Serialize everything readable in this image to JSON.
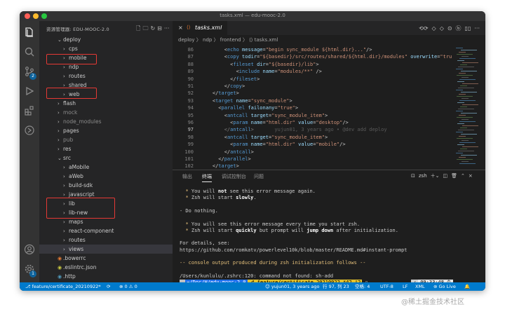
{
  "window": {
    "title": "tasks.xml — edu-mooc-2.0"
  },
  "sidebar": {
    "title": "资源管理器: EDU-MOOC-2.0",
    "tree": [
      {
        "label": "deploy",
        "indent": 0,
        "type": "folder-open",
        "dim": false
      },
      {
        "label": "cps",
        "indent": 1,
        "type": "folder",
        "dim": false
      },
      {
        "label": "mobile",
        "indent": 1,
        "type": "folder",
        "dim": false
      },
      {
        "label": "ndp",
        "indent": 1,
        "type": "folder",
        "dim": false
      },
      {
        "label": "routes",
        "indent": 1,
        "type": "folder",
        "dim": false
      },
      {
        "label": "shared",
        "indent": 1,
        "type": "folder",
        "dim": false
      },
      {
        "label": "web",
        "indent": 1,
        "type": "folder",
        "dim": false
      },
      {
        "label": "flash",
        "indent": 0,
        "type": "folder",
        "dim": false
      },
      {
        "label": "mock",
        "indent": 0,
        "type": "folder",
        "dim": true
      },
      {
        "label": "node_modules",
        "indent": 0,
        "type": "folder",
        "dim": true
      },
      {
        "label": "pages",
        "indent": 0,
        "type": "folder",
        "dim": false
      },
      {
        "label": "pub",
        "indent": 0,
        "type": "folder",
        "dim": true
      },
      {
        "label": "res",
        "indent": 0,
        "type": "folder",
        "dim": false
      },
      {
        "label": "src",
        "indent": 0,
        "type": "folder-open",
        "dim": false
      },
      {
        "label": "aMobile",
        "indent": 1,
        "type": "folder",
        "dim": false
      },
      {
        "label": "aWeb",
        "indent": 1,
        "type": "folder",
        "dim": false
      },
      {
        "label": "build-sdk",
        "indent": 1,
        "type": "folder",
        "dim": false
      },
      {
        "label": "javascript",
        "indent": 1,
        "type": "folder",
        "dim": false
      },
      {
        "label": "lib",
        "indent": 1,
        "type": "folder",
        "dim": false
      },
      {
        "label": "lib-new",
        "indent": 1,
        "type": "folder",
        "dim": false
      },
      {
        "label": "maps",
        "indent": 1,
        "type": "folder",
        "dim": false
      },
      {
        "label": "react-component",
        "indent": 1,
        "type": "folder",
        "dim": false
      },
      {
        "label": "routes",
        "indent": 1,
        "type": "folder",
        "dim": false
      },
      {
        "label": "views",
        "indent": 1,
        "type": "folder",
        "dim": false
      },
      {
        "label": ".bowerrc",
        "indent": 0,
        "type": "file",
        "dim": false
      },
      {
        "label": ".eslintrc.json",
        "indent": 0,
        "type": "file",
        "dim": false
      },
      {
        "label": ".http",
        "indent": 0,
        "type": "file",
        "dim": false
      }
    ]
  },
  "activity_badge": "2",
  "activity_badge_bottom": "1",
  "editor": {
    "tab_label": "tasks.xml",
    "breadcrumb": "deploy 〉 ndp 〉 frontend 〉 ⟨⟩ tasks.xml",
    "lines": [
      {
        "n": "86",
        "html": "        &lt;<span class='tg'>echo</span> <span class='at'>message</span>=<span class='st'>\"begin sync_module ${html.dir}...\"</span>/&gt;"
      },
      {
        "n": "87",
        "html": "        &lt;<span class='tg'>copy</span> <span class='at'>todir</span>=<span class='st'>\"${basedir}/src/routes/shared/${html.dir}/modules\"</span> <span class='at'>overwrite</span>=<span class='st'>\"tru</span>"
      },
      {
        "n": "88",
        "html": "          &lt;<span class='tg'>fileset</span> <span class='at'>dir</span>=<span class='st'>\"${basedir}/lib\"</span>&gt;"
      },
      {
        "n": "89",
        "html": "            &lt;<span class='tg'>include</span> <span class='at'>name</span>=<span class='st'>\"modules/**\"</span> /&gt;"
      },
      {
        "n": "90",
        "html": "          &lt;/<span class='tg'>fileset</span>&gt;"
      },
      {
        "n": "91",
        "html": "        &lt;/<span class='tg'>copy</span>&gt;"
      },
      {
        "n": "92",
        "html": "    &lt;/<span class='tg'>target</span>&gt;"
      },
      {
        "n": "93",
        "html": "    &lt;<span class='tg'>target</span> <span class='at'>name</span>=<span class='st'>\"sync_module\"</span>&gt;"
      },
      {
        "n": "94",
        "html": "      &lt;<span class='tg'>parallel</span> <span class='at'>failonany</span>=<span class='st'>\"true\"</span>&gt;"
      },
      {
        "n": "95",
        "html": "        &lt;<span class='tg'>antcall</span> <span class='at'>target</span>=<span class='st'>\"sync_module_item\"</span>&gt;"
      },
      {
        "n": "96",
        "html": "          &lt;<span class='tg'>param</span> <span class='at'>name</span>=<span class='st'>\"html.dir\"</span> <span class='at'>value</span>=<span class='st'>\"desktop\"</span>/&gt;"
      },
      {
        "n": "97",
        "html": "        <span class='pc'>&lt;/</span><span class='tg'>antcall</span><span class='pc'>&gt;</span>       <span class='blame'>yujun01, 3 years ago • @dev add deploy</span>",
        "current": true
      },
      {
        "n": "98",
        "html": "        &lt;<span class='tg'>antcall</span> <span class='at'>target</span>=<span class='st'>\"sync_module_item\"</span>&gt;"
      },
      {
        "n": "99",
        "html": "          &lt;<span class='tg'>param</span> <span class='at'>name</span>=<span class='st'>\"html.dir\"</span> <span class='at'>value</span>=<span class='st'>\"mobile\"</span>/&gt;"
      },
      {
        "n": "100",
        "html": "        &lt;/<span class='tg'>antcall</span>&gt;"
      },
      {
        "n": "101",
        "html": "      &lt;/<span class='tg'>parallel</span>&gt;"
      },
      {
        "n": "102",
        "html": "    &lt;/<span class='tg'>target</span>&gt;"
      }
    ]
  },
  "panel": {
    "tabs": [
      "输出",
      "终端",
      "调试控制台",
      "问题"
    ],
    "active_tab": 1,
    "shell": "zsh",
    "terminal_lines": [
      {
        "html": "  <span class='yel'>*</span> You will <span class='b'>not</span> see this error message again."
      },
      {
        "html": "  <span class='yel'>*</span> Zsh will start <span class='b'>slowly</span>."
      },
      {
        "html": ""
      },
      {
        "html": "- Do nothing."
      },
      {
        "html": ""
      },
      {
        "html": "  <span class='yel'>*</span> You will see this error message every time you start zsh."
      },
      {
        "html": "  <span class='yel'>*</span> Zsh will start <span class='b'>quickly</span> but prompt will <span class='b'>jump down</span> after initialization."
      },
      {
        "html": ""
      },
      {
        "html": "For details, see:"
      },
      {
        "html": "https://github.com/romkatv/powerlevel10k/blob/master/README.md#instant-prompt"
      },
      {
        "html": ""
      },
      {
        "html": "<span class='yel'>-- console output produced during zsh initialization follows --</span>"
      },
      {
        "html": ""
      },
      {
        "html": "/Users/kunlulu/.zshrc:120: command not found: sh-add"
      }
    ],
    "prompt": {
      "seg1": "",
      "seg2": "~/Doc/H/edu-mooc-2.0",
      "seg3": "⎇ feature/certificate_20210922 *42 !2",
      "ok": "✓",
      "time": "09:33:48 ⏱"
    }
  },
  "statusbar": {
    "branch": "feature/certificate_20210922*",
    "sync": "⟳",
    "problems": "⊗ 0 ⚠ 0",
    "blame": "yujun01, 3 years ago",
    "cursor": "行 97, 列 23",
    "spaces": "空格: 4",
    "encoding": "UTF-8",
    "eol": "LF",
    "language": "XML",
    "golive": "Go Live",
    "bell": "🔔"
  },
  "watermark": "@稀土掘金技术社区",
  "colors": {
    "activity_bar": "#333333",
    "sidebar": "#252526",
    "editor": "#1e1e1e",
    "statusbar": "#007acc",
    "annotation_red": "#e53935"
  }
}
